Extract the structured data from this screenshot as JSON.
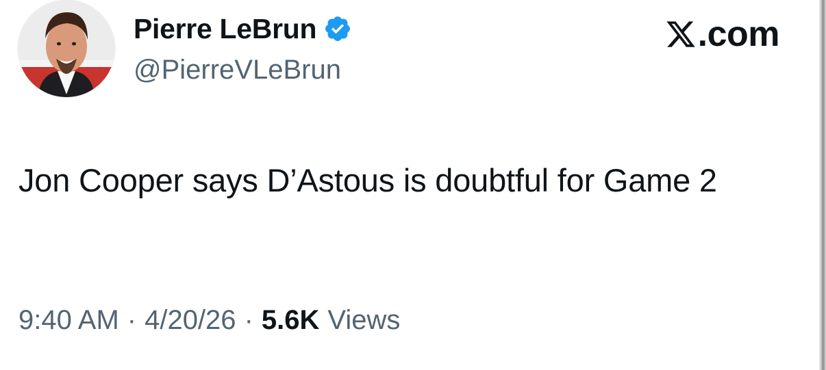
{
  "author": {
    "display_name": "Pierre LeBrun",
    "handle": "@PierreVLeBrun",
    "verified": true,
    "verified_color": "#1d9bf0"
  },
  "brand": {
    "label": ".com",
    "logo_icon": "x-logo-icon"
  },
  "tweet": {
    "text": "Jon Cooper says D’Astous is doubtful for Game 2"
  },
  "meta": {
    "time": "9:40 AM",
    "separator": "·",
    "date": "4/20/26",
    "views_count": "5.6K",
    "views_label": "Views"
  },
  "colors": {
    "text_primary": "#0f1419",
    "text_secondary": "#536471"
  }
}
